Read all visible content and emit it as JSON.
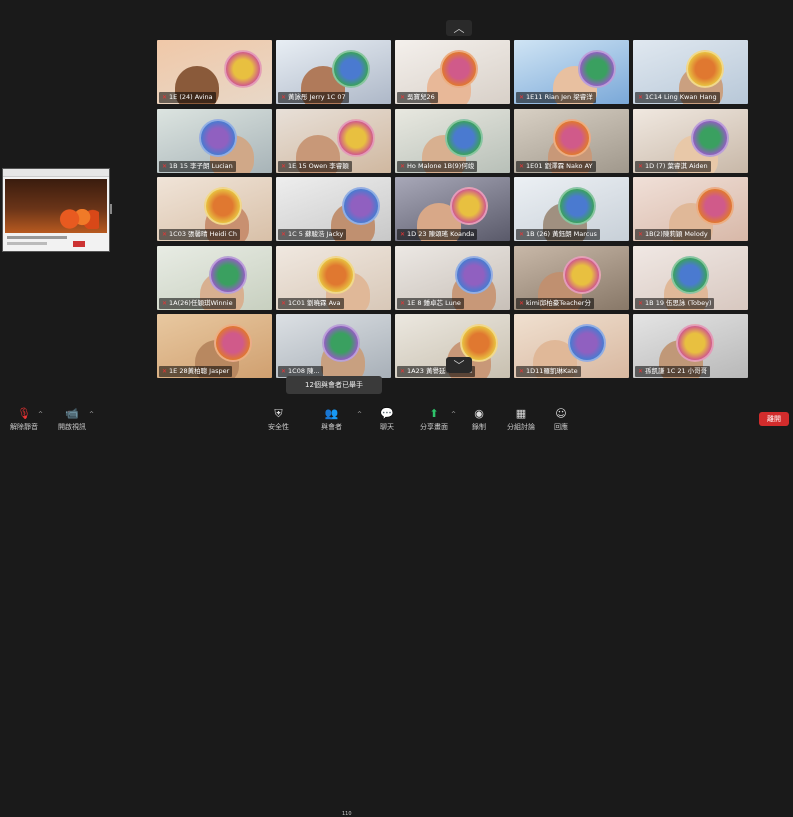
{
  "participants": [
    {
      "name": "1E (24) Avina",
      "colors": [
        "#e8d8c8",
        "#f0c8a8",
        "#8a5a3a"
      ]
    },
    {
      "name": "黃詠彤 Jerry 1C 07",
      "colors": [
        "#aeb8c8",
        "#e8eef4",
        "#b07a5a"
      ]
    },
    {
      "name": "吳寶兒26",
      "colors": [
        "#d8d0c8",
        "#f4f0ec",
        "#e8b898"
      ]
    },
    {
      "name": "1E11 Rian Jen 梁睿洋",
      "colors": [
        "#7aa8d8",
        "#cfe4f4",
        "#e8c0a0"
      ]
    },
    {
      "name": "1C14 Ling Kwan Hang",
      "colors": [
        "#b8c8d8",
        "#e0e8f0",
        "#caa080"
      ]
    },
    {
      "name": "1B 15 李子朗 Lucian",
      "colors": [
        "#a8b4b8",
        "#dce4e0",
        "#d0a888"
      ]
    },
    {
      "name": "1E 15 Owen 李睿穎",
      "colors": [
        "#d0b8a0",
        "#e8e0d8",
        "#c89878"
      ]
    },
    {
      "name": "Ho Malone 1B(9)何竣",
      "colors": [
        "#b8c0b8",
        "#e8e8e0",
        "#d8b090"
      ]
    },
    {
      "name": "1E01 劉澤霖 Nako AY",
      "colors": [
        "#a0988c",
        "#d8d0c4",
        "#c89878"
      ]
    },
    {
      "name": "1D (7) 葉睿淇 Aiden",
      "colors": [
        "#c8b8a8",
        "#f0e8e0",
        "#e8c8a8"
      ]
    },
    {
      "name": "1C03 張馨晴 Heidi Ch",
      "colors": [
        "#d8c0a8",
        "#f0e4d8",
        "#c89070"
      ]
    },
    {
      "name": "1C 5 蘇駿浩 Jacky",
      "colors": [
        "#c8c8c8",
        "#eeeeee",
        "#c09070"
      ]
    },
    {
      "name": "1D 23 陳頌瑤 Koanda",
      "colors": [
        "#5a5a6a",
        "#a8a8b8",
        "#d8a888"
      ]
    },
    {
      "name": "1B (26) 黃鈺朗 Marcus",
      "colors": [
        "#c8d0d8",
        "#ecf0f4",
        "#a09080"
      ]
    },
    {
      "name": "1B(2)陳莉穎 Melody",
      "colors": [
        "#d8b8a8",
        "#f0e0d8",
        "#e0b898"
      ]
    },
    {
      "name": "1A(26)任穎琪Winnie",
      "colors": [
        "#c8d0c0",
        "#e8ece4",
        "#d8b090"
      ]
    },
    {
      "name": "1C01 劉曉霖 Ava",
      "colors": [
        "#d8c8b8",
        "#f0e8e0",
        "#e0b898"
      ]
    },
    {
      "name": "1E 8 鍾卓芯 Lune",
      "colors": [
        "#c8c0b8",
        "#ece8e4",
        "#c89878"
      ]
    },
    {
      "name": "kimi邱柏豪Teacher分",
      "colors": [
        "#887868",
        "#c8b8a8",
        "#c09070"
      ]
    },
    {
      "name": "1B 19 伍思詠 (Tobey)",
      "colors": [
        "#d8c8c0",
        "#f0e8e4",
        "#e0b898"
      ]
    },
    {
      "name": "1E 28黃柏聰 Jasper",
      "colors": [
        "#d0a070",
        "#e8c8a0",
        "#b88860"
      ]
    },
    {
      "name": "1C08 陳...",
      "colors": [
        "#a8b0b8",
        "#dce0e4",
        "#c8a080"
      ]
    },
    {
      "name": "1A23 黃譽延 Lucas 8",
      "colors": [
        "#c8c0b0",
        "#ece8e0",
        "#c89878"
      ]
    },
    {
      "name": "1D11羅凱琳Kate",
      "colors": [
        "#d8b8a0",
        "#f0e0d0",
        "#e0b898"
      ]
    },
    {
      "name": "孫凱謙 1C 21 小哥哥",
      "colors": [
        "#b8b8b8",
        "#e4e4e4",
        "#c09878"
      ]
    }
  ],
  "toast": "12個與會者已舉手",
  "toolbar": {
    "unmute": "解除靜音",
    "start_video": "開啟視訊",
    "security": "安全性",
    "participants": "與會者",
    "participants_count": "110",
    "chat": "聊天",
    "share_screen": "分享畫面",
    "record": "錄制",
    "breakout": "分組討論",
    "reactions": "回應",
    "end": "離開"
  },
  "icons": {
    "mic": "microphone-muted-icon",
    "video": "video-off-icon",
    "shield": "shield-icon",
    "people": "people-icon",
    "chat": "chat-bubble-icon",
    "share": "share-screen-icon",
    "record": "record-icon",
    "grid": "breakout-rooms-icon",
    "smile": "reactions-icon"
  },
  "colors": {
    "end_button": "#d22c2c",
    "share_icon": "#2ec36a",
    "background": "#1a1a1a"
  }
}
